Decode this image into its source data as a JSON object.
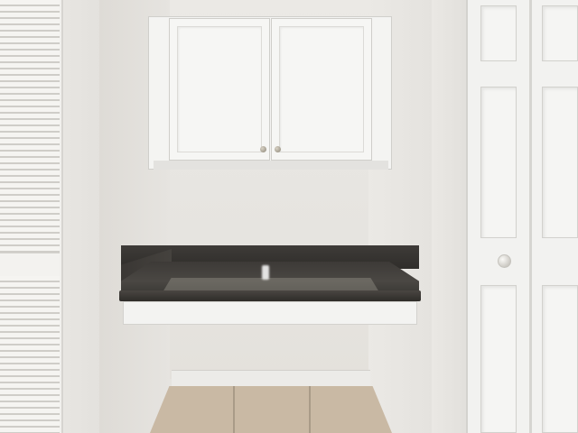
{
  "scene": {
    "colors": {
      "wall": "#e6e4e0",
      "cabinet": "#f4f4f2",
      "countertop": "#3d3a37",
      "floor_tile": "#c9b9a4",
      "door": "#f2f2f0",
      "knob": "#8c8578"
    },
    "icons": [
      "cabinet-knob-icon",
      "door-knob-icon"
    ]
  }
}
